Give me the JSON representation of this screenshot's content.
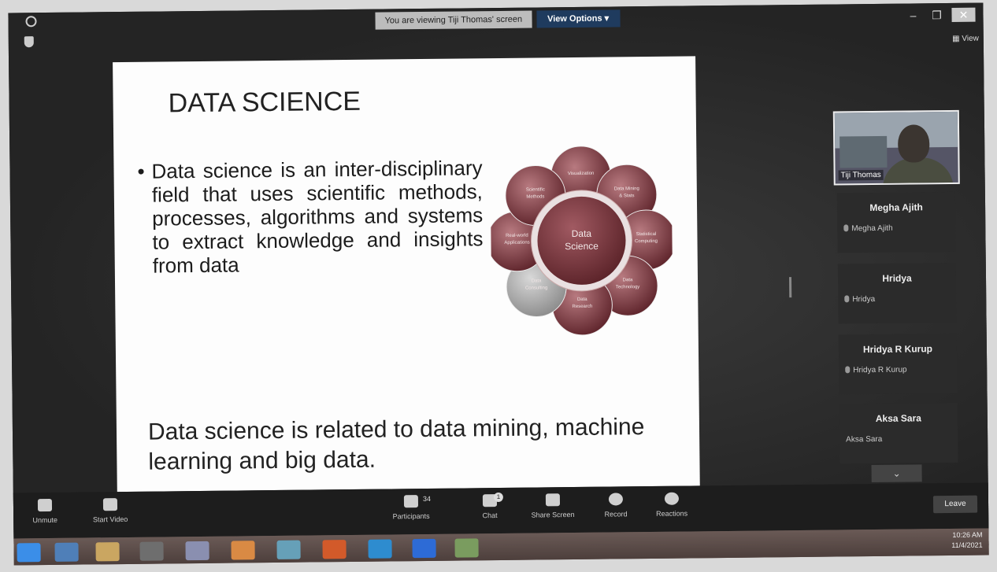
{
  "banner": {
    "viewing_text": "You are viewing Tiji Thomas' screen",
    "view_options": "View Options ▾"
  },
  "window": {
    "view_label": "View",
    "minimize": "–",
    "restore": "❐",
    "close": "✕"
  },
  "slide": {
    "title": "DATA SCIENCE",
    "bullet": "Data science is an inter-disciplinary field that uses scientific methods, processes, algorithms and systems to extract knowledge and insights from data",
    "closing": "Data science is related to data mining, machine learning and big data.",
    "diagram": {
      "center": "Data Science",
      "petals": [
        "Visualization",
        "Data Mining & Stats",
        "Statistical Computing",
        "Data Technology",
        "Data Research",
        "Data Consulting",
        "Real-world Applications",
        "Scientific Methods"
      ]
    }
  },
  "gallery": {
    "video_name": "Tiji Thomas",
    "participants": [
      {
        "display": "Megha Ajith",
        "sub": "Megha Ajith"
      },
      {
        "display": "Hridya",
        "sub": "Hridya"
      },
      {
        "display": "Hridya R Kurup",
        "sub": "Hridya R Kurup"
      },
      {
        "display": "Aksa Sara",
        "sub": "Aksa Sara"
      }
    ],
    "more": "⌄"
  },
  "toolbar": {
    "unmute": "Unmute",
    "start_video": "Start Video",
    "participants": "Participants",
    "participants_count": "34",
    "chat": "Chat",
    "chat_badge": "1",
    "share_screen": "Share Screen",
    "record": "Record",
    "reactions": "Reactions",
    "leave": "Leave"
  },
  "taskbar": {
    "time": "10:26 AM",
    "date": "11/4/2021"
  },
  "colors": {
    "petal": "#6e2f35",
    "center": "#7b3a41",
    "toolbar": "#1d1d1d",
    "banner_button": "#1f3b5e"
  }
}
